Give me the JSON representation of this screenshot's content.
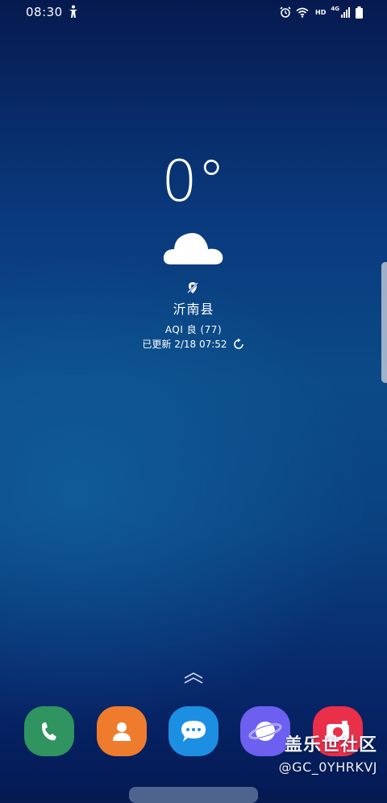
{
  "status_bar": {
    "time": "08:30",
    "hd": "HD",
    "network": "4G",
    "icons": [
      "accessibility-icon",
      "alarm-icon",
      "wifi-icon",
      "signal-icon",
      "battery-icon"
    ]
  },
  "weather": {
    "temperature": "0°",
    "condition_icon": "cloud-icon",
    "location": "沂南县",
    "aqi": "AQI 良 (77)",
    "updated": "已更新 2/18 07:52"
  },
  "dock": {
    "apps": [
      {
        "name": "phone",
        "icon": "phone-icon",
        "color": "#2f9460"
      },
      {
        "name": "contacts",
        "icon": "contacts-icon",
        "color": "#ef7b2c"
      },
      {
        "name": "messages",
        "icon": "messages-icon",
        "color": "#1c8fe3"
      },
      {
        "name": "internet",
        "icon": "internet-icon",
        "color": "#6d5ff0"
      },
      {
        "name": "camera",
        "icon": "camera-icon",
        "color": "#ea2f4a"
      }
    ]
  },
  "watermark": {
    "title": "盖乐世社区",
    "user": "@GC_0YHRKVJ"
  }
}
